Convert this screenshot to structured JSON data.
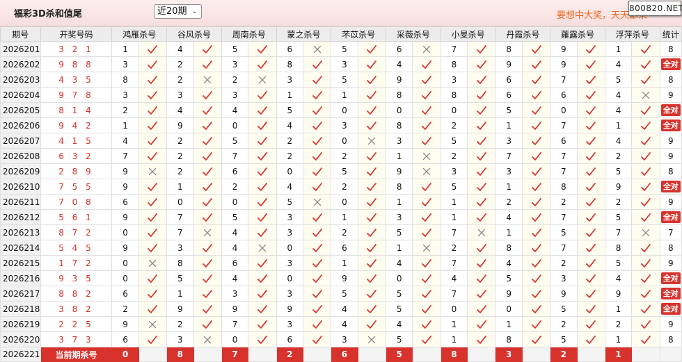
{
  "header": {
    "title": "福彩3D杀和值尾",
    "period_select": "近20期",
    "slogan": "要想中大奖，天天都来",
    "site_badge": "800820.NET"
  },
  "colors": {
    "accent": "#d8322c",
    "slogan": "#ea6a1e",
    "mark_bg": "#fffdf0"
  },
  "columns": [
    "期号",
    "开奖号码",
    "鸿雁杀号",
    "谷风杀号",
    "周南杀号",
    "蒙之杀号",
    "芣苡杀号",
    "采薇杀号",
    "小旻杀号",
    "丹霞杀号",
    "蕹露杀号",
    "浮萍杀号",
    "统计"
  ],
  "rows": [
    {
      "issue": "2026201",
      "draw": "3 2 1",
      "kills": [
        1,
        4,
        5,
        6,
        5,
        6,
        7,
        8,
        9,
        1
      ],
      "marks": "YYYNYNYYYY",
      "stat": "8"
    },
    {
      "issue": "2026202",
      "draw": "9 8 8",
      "kills": [
        3,
        2,
        3,
        8,
        3,
        4,
        8,
        9,
        9,
        4
      ],
      "marks": "YYYYYYYYYY",
      "stat": "全对"
    },
    {
      "issue": "2026203",
      "draw": "4 3 5",
      "kills": [
        8,
        2,
        2,
        3,
        5,
        9,
        3,
        6,
        7,
        5
      ],
      "marks": "YNNYYYYYYY",
      "stat": "8"
    },
    {
      "issue": "2026204",
      "draw": "9 7 8",
      "kills": [
        3,
        3,
        3,
        1,
        1,
        8,
        8,
        6,
        6,
        4
      ],
      "marks": "YYYYYYYYYN",
      "stat": "9"
    },
    {
      "issue": "2026205",
      "draw": "8 1 4",
      "kills": [
        2,
        4,
        4,
        5,
        0,
        0,
        0,
        5,
        0,
        4
      ],
      "marks": "YYYYYYYYYY",
      "stat": "全对"
    },
    {
      "issue": "2026206",
      "draw": "9 4 2",
      "kills": [
        1,
        9,
        0,
        4,
        3,
        8,
        2,
        1,
        7,
        1
      ],
      "marks": "YYYYYYYYYY",
      "stat": "全对"
    },
    {
      "issue": "2026207",
      "draw": "4 1 5",
      "kills": [
        4,
        2,
        5,
        2,
        0,
        3,
        5,
        3,
        6,
        4
      ],
      "marks": "YYYYNYYYYY",
      "stat": "9"
    },
    {
      "issue": "2026208",
      "draw": "6 3 2",
      "kills": [
        7,
        2,
        7,
        2,
        2,
        1,
        2,
        7,
        7,
        2
      ],
      "marks": "YYYYYNYYYY",
      "stat": "9"
    },
    {
      "issue": "2026209",
      "draw": "2 8 9",
      "kills": [
        9,
        2,
        6,
        0,
        5,
        9,
        3,
        3,
        7,
        5
      ],
      "marks": "NYYYYNYYYY",
      "stat": "8"
    },
    {
      "issue": "2026210",
      "draw": "7 5 5",
      "kills": [
        9,
        1,
        2,
        4,
        2,
        8,
        5,
        1,
        8,
        9
      ],
      "marks": "YYYYYYYYYY",
      "stat": "全对"
    },
    {
      "issue": "2026211",
      "draw": "7 0 8",
      "kills": [
        6,
        0,
        0,
        5,
        0,
        1,
        1,
        2,
        2,
        2
      ],
      "marks": "YYYNYYYYYY",
      "stat": "9"
    },
    {
      "issue": "2026212",
      "draw": "5 6 1",
      "kills": [
        9,
        7,
        5,
        3,
        1,
        3,
        1,
        4,
        7,
        5
      ],
      "marks": "YYYYYYYYYY",
      "stat": "全对"
    },
    {
      "issue": "2026213",
      "draw": "8 7 2",
      "kills": [
        0,
        7,
        4,
        3,
        2,
        5,
        7,
        1,
        5,
        7
      ],
      "marks": "YNYYYYNYYN",
      "stat": "7"
    },
    {
      "issue": "2026214",
      "draw": "5 4 5",
      "kills": [
        9,
        3,
        4,
        0,
        6,
        1,
        2,
        8,
        7,
        8
      ],
      "marks": "YYNYYNYYYY",
      "stat": "8"
    },
    {
      "issue": "2026215",
      "draw": "1 7 2",
      "kills": [
        0,
        8,
        6,
        3,
        1,
        4,
        7,
        4,
        2,
        5
      ],
      "marks": "NYYYYYYYYY",
      "stat": "9"
    },
    {
      "issue": "2026216",
      "draw": "9 3 5",
      "kills": [
        0,
        5,
        4,
        0,
        9,
        0,
        4,
        5,
        3,
        4
      ],
      "marks": "YYYYYYYYYY",
      "stat": "全对"
    },
    {
      "issue": "2026217",
      "draw": "8 8 2",
      "kills": [
        6,
        1,
        3,
        3,
        5,
        5,
        7,
        9,
        9,
        9
      ],
      "marks": "YYYYYYYYYY",
      "stat": "全对"
    },
    {
      "issue": "2026218",
      "draw": "3 8 2",
      "kills": [
        2,
        9,
        9,
        9,
        4,
        5,
        0,
        0,
        5,
        1
      ],
      "marks": "YYYYYYYYYY",
      "stat": "全对"
    },
    {
      "issue": "2026219",
      "draw": "2 2 5",
      "kills": [
        9,
        2,
        7,
        3,
        4,
        4,
        1,
        1,
        2,
        2
      ],
      "marks": "NYYYYYYYYY",
      "stat": "9"
    },
    {
      "issue": "2026220",
      "draw": "3 7 3",
      "kills": [
        6,
        3,
        0,
        6,
        3,
        5,
        1,
        8,
        5,
        1
      ],
      "marks": "YNYYNYYYYY",
      "stat": "8"
    }
  ],
  "current": {
    "issue": "2026221",
    "label": "当前期杀号",
    "kills": [
      0,
      8,
      7,
      2,
      6,
      5,
      8,
      3,
      2,
      1
    ]
  }
}
